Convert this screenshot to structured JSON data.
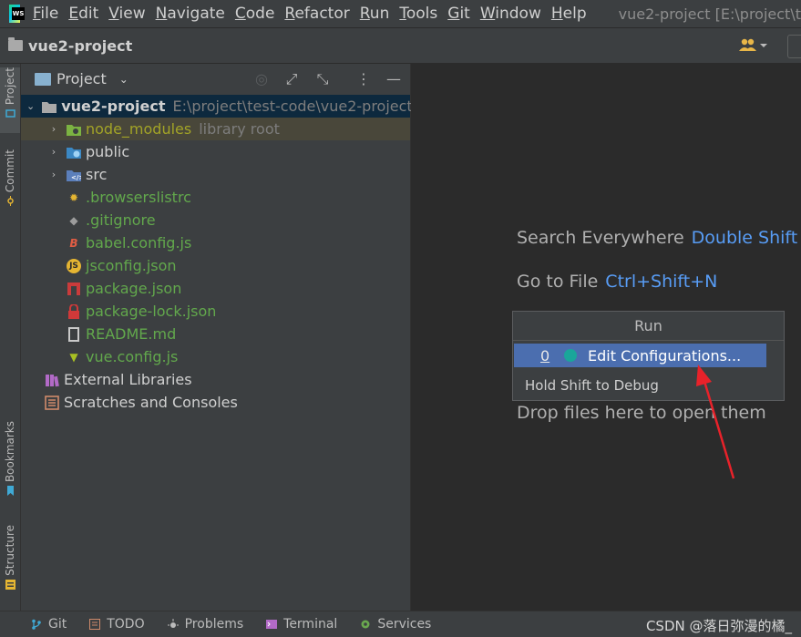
{
  "window": {
    "title": "vue2-project [E:\\project\\t"
  },
  "menu": [
    "File",
    "Edit",
    "View",
    "Navigate",
    "Code",
    "Refactor",
    "Run",
    "Tools",
    "Git",
    "Window",
    "Help"
  ],
  "navbar": {
    "project": "vue2-project"
  },
  "left_strip": {
    "project": "Project",
    "commit": "Commit",
    "bookmarks": "Bookmarks",
    "structure": "Structure"
  },
  "panel": {
    "title": "Project"
  },
  "tree": {
    "root": {
      "name": "vue2-project",
      "path": "E:\\project\\test-code\\vue2-project"
    },
    "node_modules": {
      "name": "node_modules",
      "note": "library root"
    },
    "public": "public",
    "src": "src",
    "browserslistrc": ".browserslistrc",
    "gitignore": ".gitignore",
    "babel": "babel.config.js",
    "jsconfig": "jsconfig.json",
    "package": "package.json",
    "package_lock": "package-lock.json",
    "readme": "README.md",
    "vue_config": "vue.config.js",
    "external": "External Libraries",
    "scratches": "Scratches and Consoles"
  },
  "editor": {
    "search_label": "Search Everywhere",
    "search_shortcut": "Double Shift",
    "goto_label": "Go to File",
    "goto_shortcut": "Ctrl+Shift+N",
    "drop": "Drop files here to open them"
  },
  "run_popup": {
    "title": "Run",
    "item_number": "0",
    "item_label": "Edit Configurations...",
    "footer": "Hold Shift to Debug"
  },
  "statusbar": {
    "git": "Git",
    "todo": "TODO",
    "problems": "Problems",
    "terminal": "Terminal",
    "services": "Services",
    "watermark": "CSDN @落日弥漫的橘_"
  },
  "colors": {
    "accent": "#589df6",
    "selection": "#4b6eaf",
    "file_green": "#62a84c",
    "annotation": "#e8222a"
  }
}
